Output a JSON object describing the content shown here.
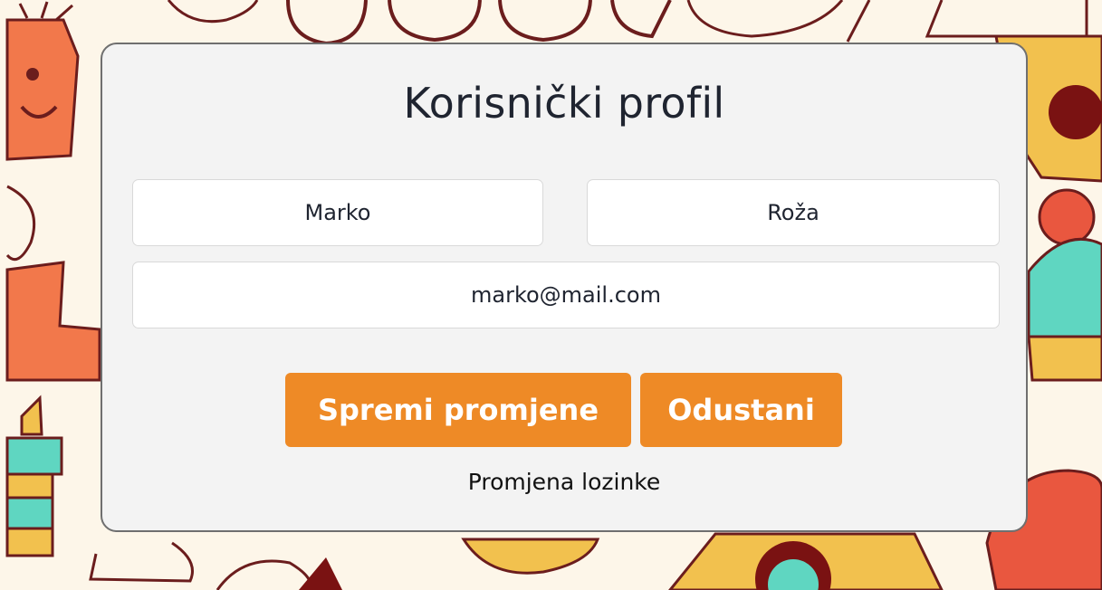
{
  "profile": {
    "title": "Korisnički profil",
    "first_name": "Marko",
    "last_name": "Roža",
    "email": "marko@mail.com"
  },
  "actions": {
    "save_label": "Spremi promjene",
    "cancel_label": "Odustani",
    "change_password_label": "Promjena lozinke"
  },
  "colors": {
    "accent": "#ee8a26",
    "card_background": "#f3f3f3",
    "page_background": "#fdf6e9",
    "title_text": "#1f2430"
  }
}
